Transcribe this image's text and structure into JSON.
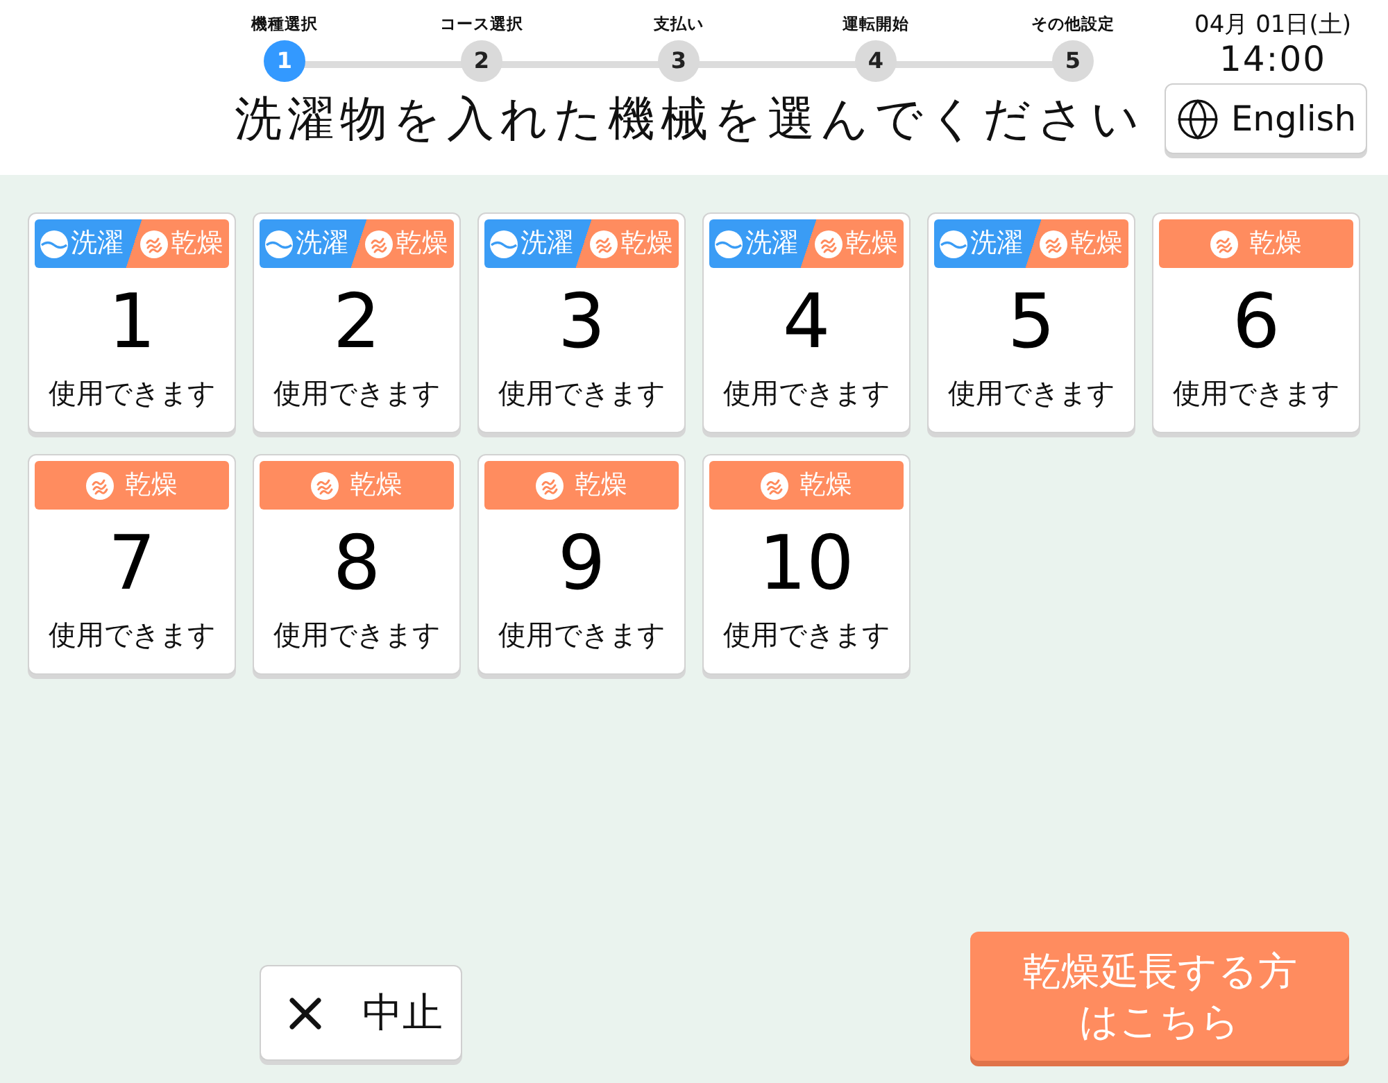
{
  "steps": [
    {
      "label": "機種選択",
      "number": "1",
      "selected": true
    },
    {
      "label": "コース選択",
      "number": "2",
      "selected": false
    },
    {
      "label": "支払い",
      "number": "3",
      "selected": false
    },
    {
      "label": "運転開始",
      "number": "4",
      "selected": false
    },
    {
      "label": "その他設定",
      "number": "5",
      "selected": false
    }
  ],
  "datetime": {
    "date": "04月 01日(土)",
    "time": "14:00"
  },
  "title": "洗濯物を入れた機械を選んでください",
  "language_button": {
    "label": "English"
  },
  "machines": [
    {
      "kind": "washer_dryer",
      "wash_label": "洗濯",
      "dry_label": "乾燥",
      "number": "1",
      "status": "使用できます"
    },
    {
      "kind": "washer_dryer",
      "wash_label": "洗濯",
      "dry_label": "乾燥",
      "number": "2",
      "status": "使用できます"
    },
    {
      "kind": "washer_dryer",
      "wash_label": "洗濯",
      "dry_label": "乾燥",
      "number": "3",
      "status": "使用できます"
    },
    {
      "kind": "washer_dryer",
      "wash_label": "洗濯",
      "dry_label": "乾燥",
      "number": "4",
      "status": "使用できます"
    },
    {
      "kind": "washer_dryer",
      "wash_label": "洗濯",
      "dry_label": "乾燥",
      "number": "5",
      "status": "使用できます"
    },
    {
      "kind": "dryer",
      "dry_label": "乾燥",
      "number": "6",
      "status": "使用できます"
    },
    {
      "kind": "dryer",
      "dry_label": "乾燥",
      "number": "7",
      "status": "使用できます"
    },
    {
      "kind": "dryer",
      "dry_label": "乾燥",
      "number": "8",
      "status": "使用できます"
    },
    {
      "kind": "dryer",
      "dry_label": "乾燥",
      "number": "9",
      "status": "使用できます"
    },
    {
      "kind": "dryer",
      "dry_label": "乾燥",
      "number": "10",
      "status": "使用できます"
    }
  ],
  "cancel_button": {
    "label": "中止"
  },
  "dry_extension_button": {
    "label": "乾燥延長する方はこちら"
  }
}
